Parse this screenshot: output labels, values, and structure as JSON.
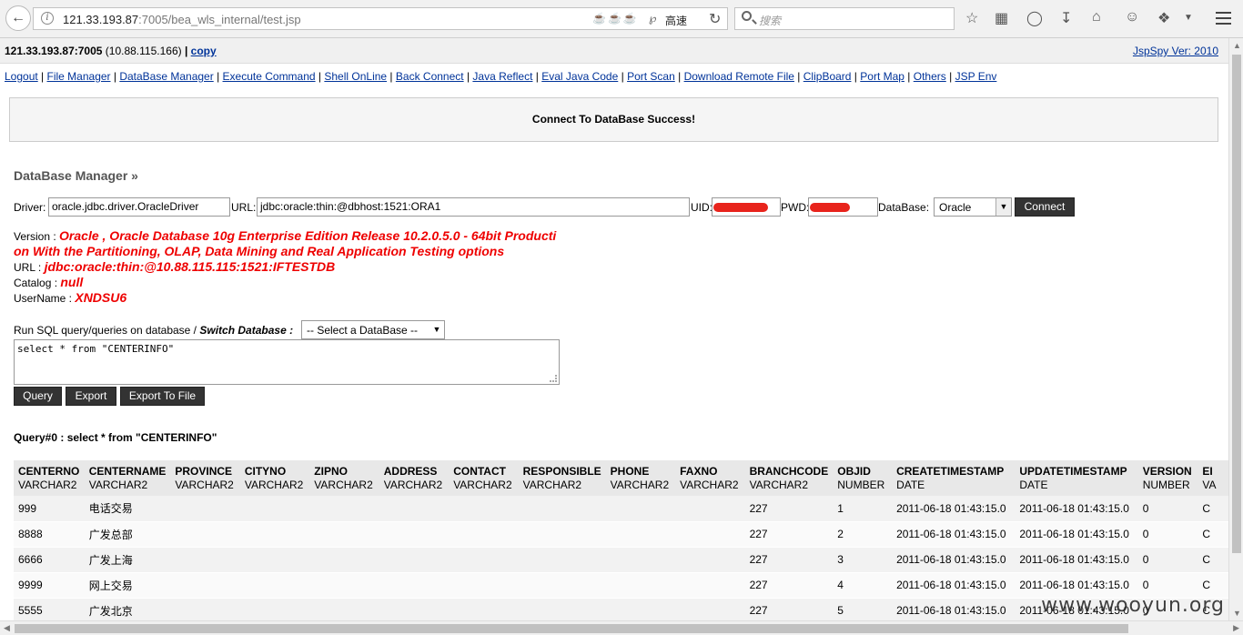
{
  "browser": {
    "url_host": "121.33.193.87",
    "url_rest": ":7005/bea_wls_internal/test.jsp",
    "speed_label": "高速",
    "search_placeholder": "搜索"
  },
  "header": {
    "host_bold": "121.33.193.87:7005",
    "host_ip": "(10.88.115.166)",
    "separator": "|",
    "copy_label": "copy",
    "version_link": "JspSpy Ver: 2010"
  },
  "nav": [
    "Logout",
    "File Manager",
    "DataBase Manager",
    "Execute Command",
    "Shell OnLine",
    "Back Connect",
    "Java Reflect",
    "Eval Java Code",
    "Port Scan",
    "Download Remote File",
    "ClipBoard",
    "Port Map",
    "Others",
    "JSP Env"
  ],
  "message": "Connect To DataBase Success!",
  "dbm": {
    "title": "DataBase Manager »",
    "driver_label": "Driver:",
    "driver_value": "oracle.jdbc.driver.OracleDriver",
    "url_label": "URL:",
    "url_value": "jdbc:oracle:thin:@dbhost:1521:ORA1",
    "uid_label": "UID:",
    "pwd_label": "PWD:",
    "database_label": "DataBase:",
    "database_value": "Oracle",
    "connect_label": "Connect"
  },
  "info": {
    "version_label": "Version :",
    "version_value_1": "Oracle , Oracle Database 10g Enterprise Edition Release 10.2.0.5.0 - 64bit Producti",
    "version_value_2": "on With the Partitioning, OLAP, Data Mining and Real Application Testing options",
    "url_label": "URL :",
    "url_value": "jdbc:oracle:thin:@10.88.115.115:1521:IFTESTDB",
    "catalog_label": "Catalog :",
    "catalog_value": "null",
    "username_label": "UserName :",
    "username_value": "XNDSU6"
  },
  "sql": {
    "run_label": "Run SQL query/queries on database /",
    "switch_label": "Switch Database :",
    "select_value": "-- Select a DataBase --",
    "query_text": "select * from \"CENTERINFO\"",
    "buttons": [
      "Query",
      "Export",
      "Export To File"
    ]
  },
  "result": {
    "label": "Query#0 : select * from \"CENTERINFO\"",
    "columns": [
      {
        "name": "CENTERNO",
        "type": "VARCHAR2"
      },
      {
        "name": "CENTERNAME",
        "type": "VARCHAR2"
      },
      {
        "name": "PROVINCE",
        "type": "VARCHAR2"
      },
      {
        "name": "CITYNO",
        "type": "VARCHAR2"
      },
      {
        "name": "ZIPNO",
        "type": "VARCHAR2"
      },
      {
        "name": "ADDRESS",
        "type": "VARCHAR2"
      },
      {
        "name": "CONTACT",
        "type": "VARCHAR2"
      },
      {
        "name": "RESPONSIBLE",
        "type": "VARCHAR2"
      },
      {
        "name": "PHONE",
        "type": "VARCHAR2"
      },
      {
        "name": "FAXNO",
        "type": "VARCHAR2"
      },
      {
        "name": "BRANCHCODE",
        "type": "VARCHAR2"
      },
      {
        "name": "OBJID",
        "type": "NUMBER"
      },
      {
        "name": "CREATETIMESTAMP",
        "type": "DATE"
      },
      {
        "name": "UPDATETIMESTAMP",
        "type": "DATE"
      },
      {
        "name": "VERSION",
        "type": "NUMBER"
      },
      {
        "name": "EI",
        "type": "VA"
      }
    ],
    "rows": [
      [
        "999",
        "电话交易",
        "",
        "",
        "",
        "",
        "",
        "",
        "",
        "",
        "227",
        "1",
        "2011-06-18 01:43:15.0",
        "2011-06-18 01:43:15.0",
        "0",
        "C"
      ],
      [
        "8888",
        "广发总部",
        "",
        "",
        "",
        "",
        "",
        "",
        "",
        "",
        "227",
        "2",
        "2011-06-18 01:43:15.0",
        "2011-06-18 01:43:15.0",
        "0",
        "C"
      ],
      [
        "6666",
        "广发上海",
        "",
        "",
        "",
        "",
        "",
        "",
        "",
        "",
        "227",
        "3",
        "2011-06-18 01:43:15.0",
        "2011-06-18 01:43:15.0",
        "0",
        "C"
      ],
      [
        "9999",
        "网上交易",
        "",
        "",
        "",
        "",
        "",
        "",
        "",
        "",
        "227",
        "4",
        "2011-06-18 01:43:15.0",
        "2011-06-18 01:43:15.0",
        "0",
        "C"
      ],
      [
        "5555",
        "广发北京",
        "",
        "",
        "",
        "",
        "",
        "",
        "",
        "",
        "227",
        "5",
        "2011-06-18 01:43:15.0",
        "2011-06-18 01:43:15.0",
        "0",
        "C"
      ]
    ]
  },
  "watermark": "www.wooyun.org"
}
